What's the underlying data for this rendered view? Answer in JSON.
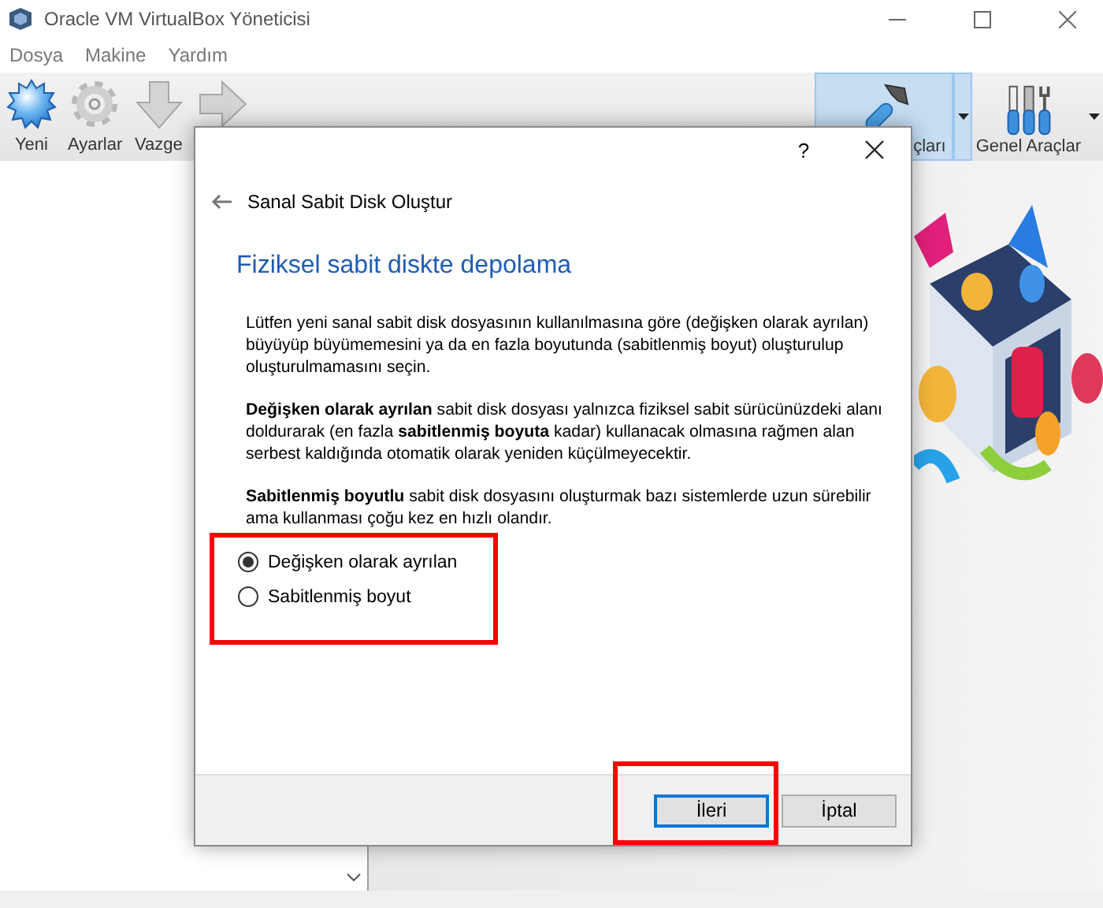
{
  "window": {
    "title": "Oracle VM VirtualBox Yöneticisi"
  },
  "menu": [
    "Dosya",
    "Makine",
    "Yardım"
  ],
  "toolbar": [
    {
      "kind": "new",
      "label": "Yeni"
    },
    {
      "kind": "settings",
      "label": "Ayarlar"
    },
    {
      "kind": "discard",
      "label": "Vazge"
    },
    {
      "kind": "start"
    }
  ],
  "tools": [
    {
      "kind": "machine",
      "label": "çları",
      "selected": true
    },
    {
      "kind": "global",
      "label": "Genel Araçlar",
      "selected": false
    }
  ],
  "dialog": {
    "help": "?",
    "title": "Sanal Sabit Disk Oluştur",
    "heading": "Fiziksel sabit diskte depolama",
    "paragraphs": [
      "Lütfen yeni sanal sabit disk dosyasının kullanılmasına göre (değişken olarak ayrılan) büyüyüp büyümemesini ya da en fazla boyutunda (sabitlenmiş boyut) oluşturulup oluşturulmamasını seçin.",
      "**Değişken olarak ayrılan** sabit disk dosyası yalnızca fiziksel sabit sürücünüzdeki alanı doldurarak (en fazla **sabitlenmiş boyuta** kadar) kullanacak olmasına rağmen alan serbest kaldığında otomatik olarak yeniden küçülmeyecektir.",
      "**Sabitlenmiş boyutlu** sabit disk dosyasını oluşturmak bazı sistemlerde uzun sürebilir ama kullanması çoğu kez en hızlı olandır."
    ],
    "options": [
      {
        "label": "Değişken olarak ayrılan",
        "selected": true
      },
      {
        "label": "Sabitlenmiş boyut",
        "selected": false
      }
    ],
    "buttons": [
      {
        "label": "İleri",
        "default": true
      },
      {
        "label": "İptal",
        "default": false
      }
    ]
  }
}
